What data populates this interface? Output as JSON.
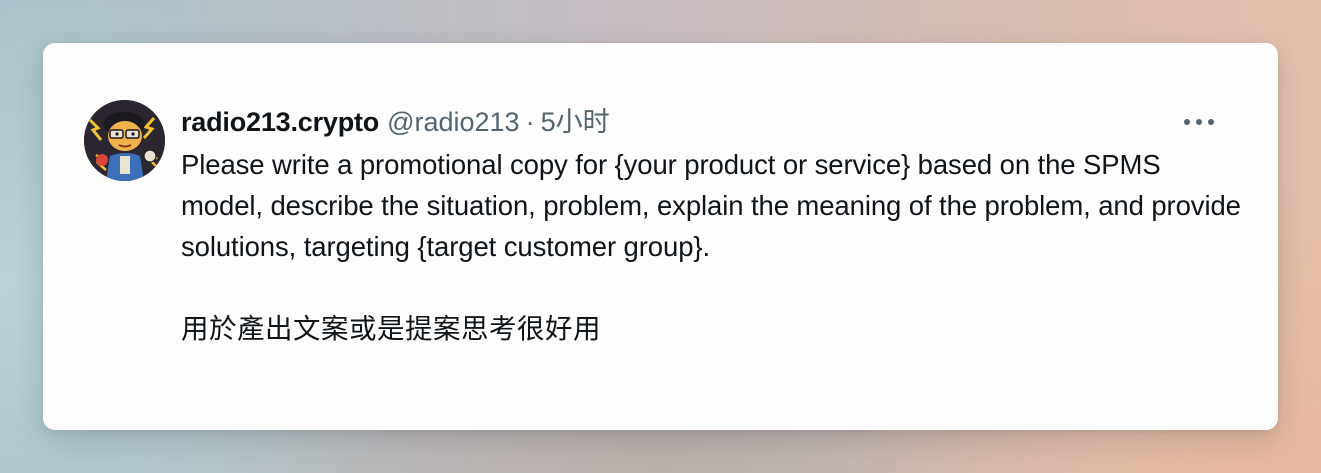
{
  "tweet": {
    "author": {
      "display_name": "radio213.crypto",
      "handle": "@radio213",
      "avatar_icon": "cartoon-character-avatar"
    },
    "separator": "·",
    "timestamp": "5小时",
    "more_icon": "more-horizontal-icon",
    "text_en": "Please write a promotional copy for {your product or service} based on the SPMS model, describe the situation, problem, explain the meaning of the problem, and provide solutions, targeting {target customer group}.",
    "text_zh": "用於產出文案或是提案思考很好用"
  },
  "colors": {
    "primary_text": "#0f1419",
    "secondary_text": "#536471",
    "card_background": "#fdfdfd"
  }
}
